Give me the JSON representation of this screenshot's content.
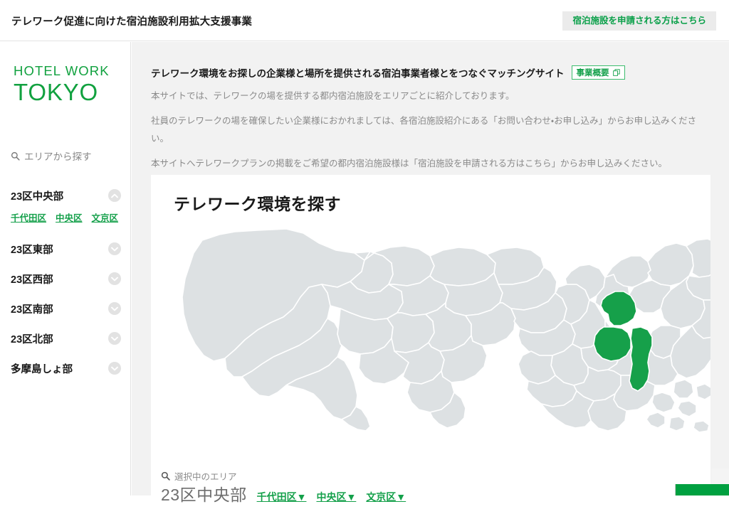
{
  "header": {
    "site_title": "テレワーク促進に向けた宿泊施設利用拡大支援事業",
    "apply_button": "宿泊施設を申請される方はこちら"
  },
  "sidebar": {
    "logo_top": "HOTEL WORK",
    "logo_bottom": "TOKYO",
    "search_heading": "エリアから探す",
    "search_icon": "search-icon",
    "groups": [
      {
        "label": "23区中央部",
        "expanded": true,
        "icon": "chevron-up-icon",
        "wards": [
          "千代田区",
          "中央区",
          "文京区"
        ]
      },
      {
        "label": "23区東部",
        "expanded": false,
        "icon": "chevron-down-icon",
        "wards": []
      },
      {
        "label": "23区西部",
        "expanded": false,
        "icon": "chevron-down-icon",
        "wards": []
      },
      {
        "label": "23区南部",
        "expanded": false,
        "icon": "chevron-down-icon",
        "wards": []
      },
      {
        "label": "23区北部",
        "expanded": false,
        "icon": "chevron-down-icon",
        "wards": []
      },
      {
        "label": "多摩島しょ部",
        "expanded": false,
        "icon": "chevron-down-icon",
        "wards": []
      }
    ]
  },
  "main": {
    "intro_title": "テレワーク環境をお探しの企業様と場所を提供される宿泊事業者様とをつなぐマッチングサイト",
    "overview_button": "事業概要",
    "overview_icon": "external-link-icon",
    "paragraphs": [
      "本サイトでは、テレワークの場を提供する都内宿泊施設をエリアごとに紹介しております。",
      "社員のテレワークの場を確保したい企業様におかれましては、各宿泊施設紹介にある「お問い合わせ・お申し込み」からお申し込みください。",
      "本サイトへテレワークプランの掲載をご希望の都内宿泊施設様は「宿泊施設を申請される方はこちら」からお申し込みください。"
    ],
    "card": {
      "title": "テレワーク環境を探す",
      "selected_heading": "選択中のエリア",
      "selected_icon": "search-icon",
      "selected_area": "23区中央部",
      "selected_wards": [
        "千代田区▼",
        "中央区▼",
        "文京区▼"
      ],
      "map": {
        "name": "tokyo-area-map",
        "base_color": "#dde1e3",
        "border_color": "#ffffff",
        "highlight_color": "#16a04a",
        "highlighted_areas": [
          "文京区",
          "千代田区",
          "中央区"
        ]
      }
    }
  },
  "colors": {
    "brand_green": "#11a13f",
    "link_green": "#14a04a",
    "page_bg": "#f2f2f2",
    "header_button_bg": "#ebebeb"
  }
}
